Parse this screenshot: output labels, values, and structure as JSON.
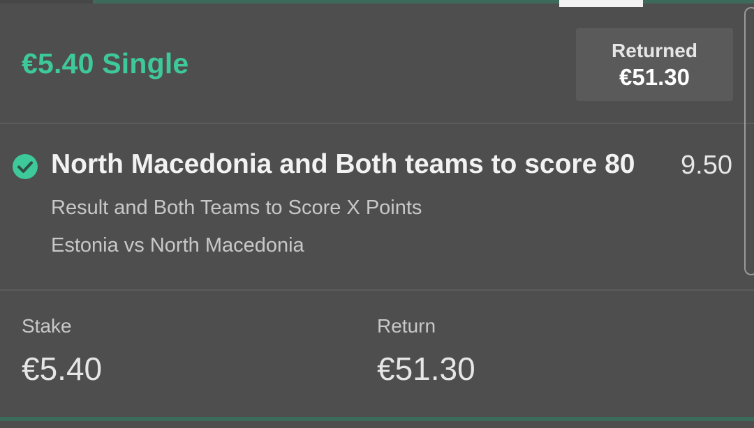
{
  "bet": {
    "title": "€5.40 Single",
    "returned_label": "Returned",
    "returned_value": "€51.30",
    "status_icon": "check-circle-icon",
    "accent_color": "#3ec99a"
  },
  "selection": {
    "name": "North Macedonia and Both teams to score 80",
    "odds": "9.50",
    "market": "Result and Both Teams to Score X Points",
    "event": "Estonia vs North Macedonia"
  },
  "footer": {
    "stake_label": "Stake",
    "stake_value": "€5.40",
    "return_label": "Return",
    "return_value": "€51.30"
  }
}
